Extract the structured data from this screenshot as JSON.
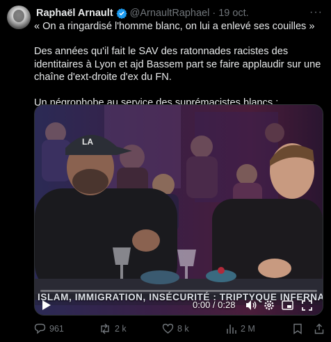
{
  "author": {
    "name": "Raphaël Arnault",
    "handle": "@ArnaultRaphael",
    "separator": "·",
    "date": "19 oct."
  },
  "tweet": {
    "line1": "« On a ringardisé l'homme blanc, on lui a enlevé ses couilles »",
    "line2": "Des années qu'il fait le SAV des ratonnades racistes des identitaires à Lyon et ajd Bassem part se faire applaudir sur une chaîne d'ext-droite d'ex du FN.",
    "line3": "Un négrophobe au service des suprémacistes blancs :"
  },
  "video": {
    "ticker": "ISLAM, IMMIGRATION, INSÉCURITÉ : TRIPTYQUE INFERNAL",
    "time": "0:00 / 0:28",
    "progress": 0.0
  },
  "actions": {
    "replies": "961",
    "reposts": "2 k",
    "likes": "8 k",
    "views": "2 M"
  },
  "colors": {
    "background": "#000000",
    "text": "#e7e9ea",
    "muted": "#71767b",
    "verified": "#1d9bf0"
  }
}
